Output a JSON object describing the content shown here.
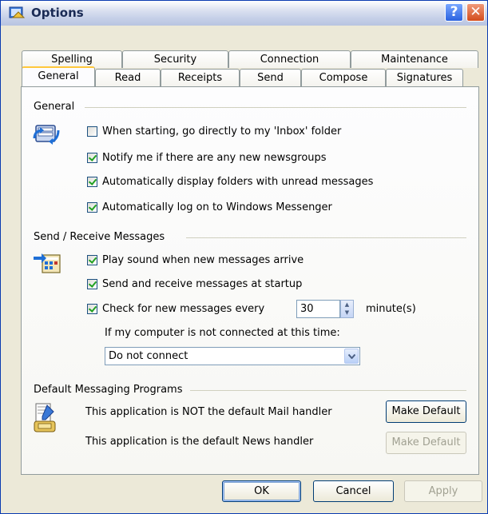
{
  "window": {
    "title": "Options"
  },
  "tabs_back": [
    "Spelling",
    "Security",
    "Connection",
    "Maintenance"
  ],
  "tabs_front": [
    "General",
    "Read",
    "Receipts",
    "Send",
    "Compose",
    "Signatures"
  ],
  "active_tab": "General",
  "general": {
    "title": "General",
    "options": [
      {
        "label": "When starting, go directly to my 'Inbox' folder",
        "checked": false
      },
      {
        "label": "Notify me if there are any new newsgroups",
        "checked": true
      },
      {
        "label": "Automatically display folders with unread messages",
        "checked": true
      },
      {
        "label": "Automatically log on to Windows Messenger",
        "checked": true
      }
    ]
  },
  "send_receive": {
    "title": "Send / Receive Messages",
    "play_sound": {
      "label": "Play sound when new messages arrive",
      "checked": true
    },
    "send_receive_startup": {
      "label": "Send and receive messages at startup",
      "checked": true
    },
    "check_every": {
      "label": "Check for new messages every",
      "checked": true,
      "value": "30",
      "unit": "minute(s)"
    },
    "not_connected_label": "If my computer is not connected at this time:",
    "connect_option": "Do not connect"
  },
  "default_programs": {
    "title": "Default Messaging Programs",
    "mail_text": "This application is NOT the default Mail handler",
    "news_text": "This application is the default News handler",
    "mail_button": "Make Default",
    "news_button": "Make Default"
  },
  "buttons": {
    "ok": "OK",
    "cancel": "Cancel",
    "apply": "Apply"
  },
  "colors": {
    "titlebar_border": "#0A3BB0",
    "dialog_bg": "#ECE9D8",
    "tab_highlight": "#FFC83C",
    "check_green": "#21A121"
  }
}
